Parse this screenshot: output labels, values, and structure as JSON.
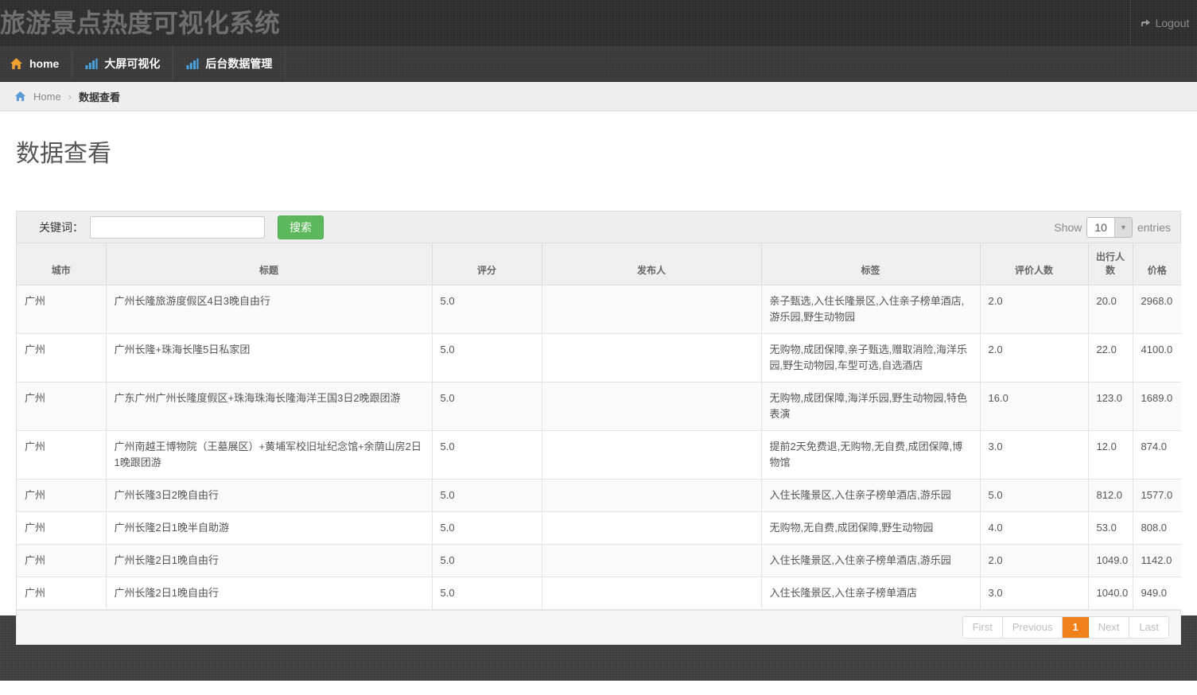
{
  "header": {
    "app_title": "旅游景点热度可视化系统",
    "logout_label": "Logout",
    "logout_icon": "sign-out-icon"
  },
  "nav": {
    "items": [
      {
        "label": "home",
        "icon": "home-icon",
        "icon_color": "#f0a030"
      },
      {
        "label": "大屏可视化",
        "icon": "bar-chart-icon",
        "icon_color": "#4aa3df"
      },
      {
        "label": "后台数据管理",
        "icon": "bar-chart-icon",
        "icon_color": "#4aa3df"
      }
    ]
  },
  "breadcrumb": {
    "home_icon": "home-icon",
    "home_label": "Home",
    "separator": "›",
    "current": "数据查看"
  },
  "page": {
    "title": "数据查看"
  },
  "toolbar": {
    "keyword_label": "关键词：",
    "keyword_value": "",
    "keyword_placeholder": "",
    "search_label": "搜索",
    "search_color": "#5cb85c",
    "show_prefix": "Show",
    "entries_value": "10",
    "entries_arrow": "▼",
    "show_suffix": "entries"
  },
  "table": {
    "columns": [
      "城市",
      "标题",
      "评分",
      "发布人",
      "标签",
      "评价人数",
      "出行人数",
      "价格"
    ],
    "rows": [
      {
        "city": "广州",
        "title": "广州长隆旅游度假区4日3晚自由行",
        "score": "5.0",
        "publisher": "",
        "tags": "亲子甄选,入住长隆景区,入住亲子榜单酒店,游乐园,野生动物园",
        "reviews": "2.0",
        "travelers": "20.0",
        "price": "2968.0"
      },
      {
        "city": "广州",
        "title": "广州长隆+珠海长隆5日私家团",
        "score": "5.0",
        "publisher": "",
        "tags": "无购物,成团保障,亲子甄选,赠取消险,海洋乐园,野生动物园,车型可选,自选酒店",
        "reviews": "2.0",
        "travelers": "22.0",
        "price": "4100.0"
      },
      {
        "city": "广州",
        "title": "广东广州广州长隆度假区+珠海珠海长隆海洋王国3日2晚跟团游",
        "score": "5.0",
        "publisher": "",
        "tags": "无购物,成团保障,海洋乐园,野生动物园,特色表演",
        "reviews": "16.0",
        "travelers": "123.0",
        "price": "1689.0"
      },
      {
        "city": "广州",
        "title": "广州南越王博物院（王墓展区）+黄埔军校旧址纪念馆+余荫山房2日1晚跟团游",
        "score": "5.0",
        "publisher": "",
        "tags": "提前2天免费退,无购物,无自费,成团保障,博物馆",
        "reviews": "3.0",
        "travelers": "12.0",
        "price": "874.0"
      },
      {
        "city": "广州",
        "title": "广州长隆3日2晚自由行",
        "score": "5.0",
        "publisher": "",
        "tags": "入住长隆景区,入住亲子榜单酒店,游乐园",
        "reviews": "5.0",
        "travelers": "812.0",
        "price": "1577.0"
      },
      {
        "city": "广州",
        "title": "广州长隆2日1晚半自助游",
        "score": "5.0",
        "publisher": "",
        "tags": "无购物,无自费,成团保障,野生动物园",
        "reviews": "4.0",
        "travelers": "53.0",
        "price": "808.0"
      },
      {
        "city": "广州",
        "title": "广州长隆2日1晚自由行",
        "score": "5.0",
        "publisher": "",
        "tags": "入住长隆景区,入住亲子榜单酒店,游乐园",
        "reviews": "2.0",
        "travelers": "1049.0",
        "price": "1142.0"
      },
      {
        "city": "广州",
        "title": "广州长隆2日1晚自由行",
        "score": "5.0",
        "publisher": "",
        "tags": "入住长隆景区,入住亲子榜单酒店",
        "reviews": "3.0",
        "travelers": "1040.0",
        "price": "949.0"
      }
    ]
  },
  "pagination": {
    "first": "First",
    "previous": "Previous",
    "current": "1",
    "next": "Next",
    "last": "Last",
    "active_color": "#f0801a"
  }
}
